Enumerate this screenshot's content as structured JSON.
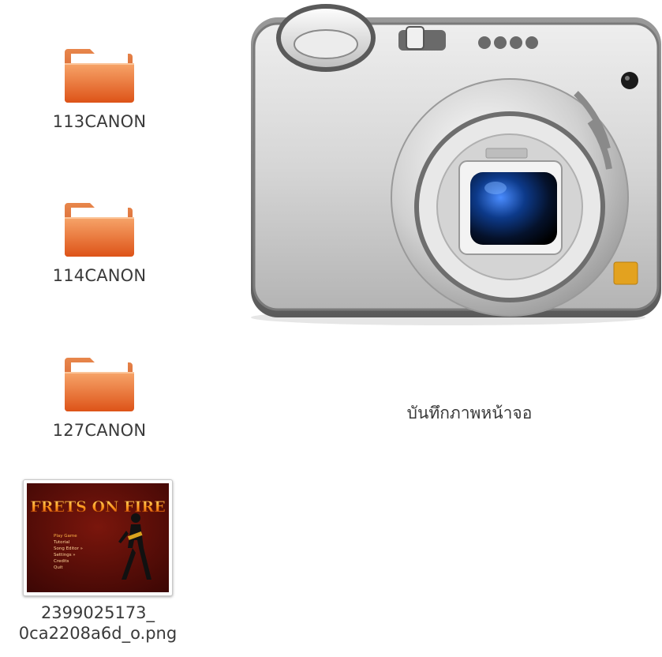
{
  "desktop": {
    "folders": [
      {
        "name": "113CANON",
        "icon": "folder-icon"
      },
      {
        "name": "114CANON",
        "icon": "folder-icon"
      },
      {
        "name": "127CANON",
        "icon": "folder-icon"
      }
    ],
    "file": {
      "name_line1": "2399025173_",
      "name_line2": "0ca2208a6d_o.png",
      "icon": "image-thumbnail",
      "thumbnail": {
        "title": "FRETS ON FIRE",
        "menu": [
          "Play Game",
          "Tutorial",
          "Song Editor »",
          "Settings »",
          "Credits",
          "Quit"
        ]
      }
    },
    "device": {
      "label": "บันทึกภาพหน้าจอ",
      "icon": "camera-icon"
    }
  },
  "colors": {
    "folder_top": "#f7a56a",
    "folder_bottom": "#e0551a",
    "label_text": "#3a3a3a",
    "thumb_bg": "#5a0d08",
    "camera_body": "#d4d4d4"
  }
}
